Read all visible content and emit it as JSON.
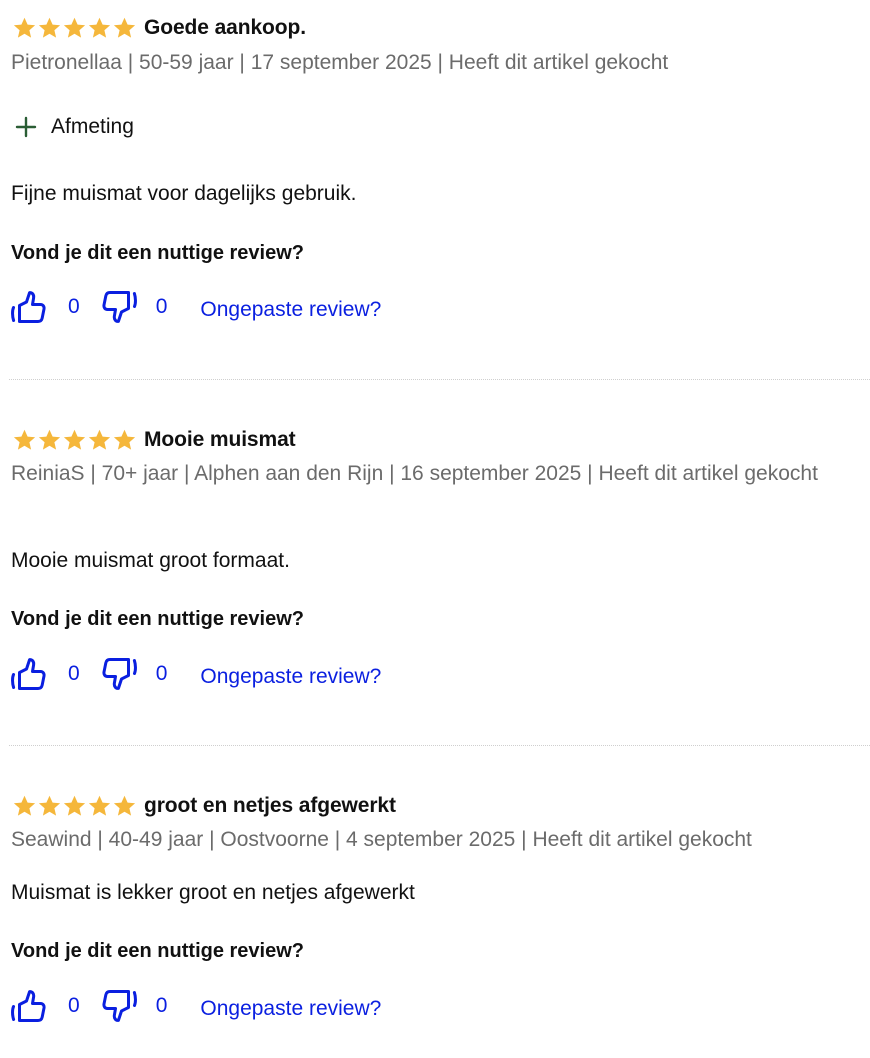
{
  "colors": {
    "star": "#f5b73b",
    "link": "#0a1fe0",
    "meta": "#6b6b6b",
    "plus": "#2a5d34"
  },
  "icons": {
    "star": "star-icon",
    "plus": "plus-icon",
    "up": "thumbs-up-icon",
    "down": "thumbs-down-icon"
  },
  "reviews": [
    {
      "rating": 5,
      "title": "Goede aankoop.",
      "meta": "Pietronellaa | 50-59 jaar | 17 september 2025 | Heeft dit artikel gekocht",
      "expander": "Afmeting",
      "body": "Fijne muismat voor dagelijks gebruik.",
      "helpful_question": "Vond je dit een nuttige review?",
      "up_count": "0",
      "down_count": "0",
      "report_label": "Ongepaste review?"
    },
    {
      "rating": 5,
      "title": "Mooie muismat",
      "meta": "ReiniaS | 70+ jaar | Alphen aan den Rijn | 16 september 2025 | Heeft dit artikel gekocht",
      "body": "Mooie muismat groot formaat.",
      "helpful_question": "Vond je dit een nuttige review?",
      "up_count": "0",
      "down_count": "0",
      "report_label": "Ongepaste review?"
    },
    {
      "rating": 5,
      "title": "groot en netjes afgewerkt",
      "meta": "Seawind | 40-49 jaar | Oostvoorne | 4 september 2025 | Heeft dit artikel gekocht",
      "body": "Muismat is lekker groot en netjes afgewerkt",
      "helpful_question": "Vond je dit een nuttige review?",
      "up_count": "0",
      "down_count": "0",
      "report_label": "Ongepaste review?"
    }
  ]
}
